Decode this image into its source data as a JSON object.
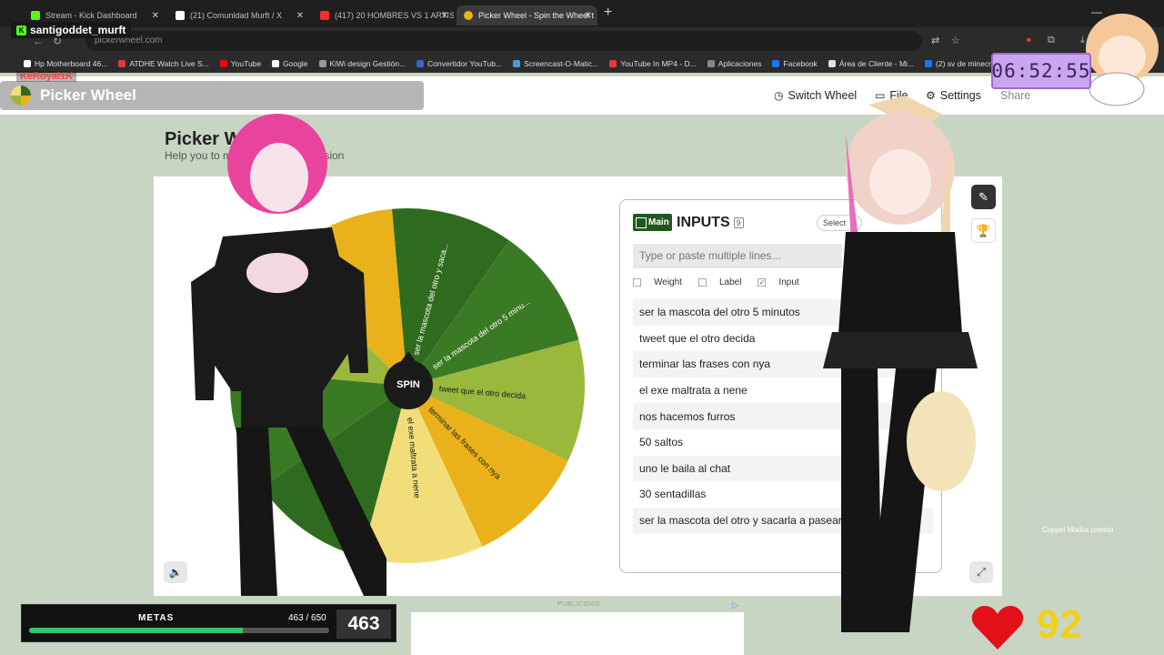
{
  "browser": {
    "tabs": [
      {
        "label": "Stream - Kick Dashboard",
        "color": "#53fc18",
        "active": false
      },
      {
        "label": "(21) Comunidad Murft / X",
        "color": "#ffffff",
        "active": false
      },
      {
        "label": "(417) 20 HOMBRES VS 1 ARTIS",
        "color": "#ff2a2a",
        "active": false
      },
      {
        "label": "Picker Wheel - Spin the Wheel t",
        "color": "#e9b21a",
        "active": true
      }
    ],
    "url": "pickerwheel.com",
    "bookmarks": [
      {
        "label": "Hp Motherboard 46...",
        "color": "#ffffff"
      },
      {
        "label": "ATDHE Watch Live S...",
        "color": "#e23a3a"
      },
      {
        "label": "YouTube",
        "color": "#ff0000"
      },
      {
        "label": "Google",
        "color": "#ffffff"
      },
      {
        "label": "KiWi design Gestión...",
        "color": "#999999"
      },
      {
        "label": "Convertidor YouTub...",
        "color": "#3366cc"
      },
      {
        "label": "Screencast-O-Matic...",
        "color": "#3aa0e6"
      },
      {
        "label": "YouTube In MP4 - D...",
        "color": "#e23a3a"
      },
      {
        "label": "Aplicaciones",
        "color": "#888888"
      },
      {
        "label": "Facebook",
        "color": "#1877f2"
      },
      {
        "label": "Área de Cliente - Mi...",
        "color": "#e0e0e0"
      },
      {
        "label": "(2) sv de minecraft...",
        "color": "#1877f2"
      }
    ]
  },
  "site": {
    "brand": "Picker Wheel",
    "nav": {
      "switch": "Switch Wheel",
      "file": "File",
      "settings": "Settings",
      "share": "Share"
    },
    "title": "Picker Wh",
    "subtitle_start": "Help you to m",
    "subtitle_end": "ecision"
  },
  "wheel": {
    "spin_label": "SPIN",
    "colors": [
      "#2f6b1e",
      "#3a7a24",
      "#9ab83b",
      "#e9b21a",
      "#f1de7a"
    ],
    "slices": [
      "ser la mascota del otro y saca...",
      "ser la mascota del otro 5 minu...",
      "tweet que el otro decida",
      "terminar las frases con nya",
      "el exe maltrata a nene"
    ]
  },
  "inputs": {
    "badge": "Main",
    "title": "INPUTS",
    "count": "9",
    "select": "Select",
    "placeholder": "Type or paste multiple lines...",
    "options": {
      "weight": "Weight",
      "label": "Label",
      "input": "Input"
    },
    "items": [
      "ser la mascota del otro 5 minutos",
      "tweet que el otro decida",
      "terminar las frases con nya",
      "el exe maltrata a nene",
      "nos hacemos furros",
      "50 saltos",
      "uno le baila al chat",
      "30 sentadillas",
      "ser la mascota del otro y sacarla a pasear"
    ]
  },
  "ad": {
    "label": "PUBLICIDAD"
  },
  "stream": {
    "chat_user": "santigoddet_murft",
    "chat_user2": "KeRoyal1K",
    "timer": "06:52:55",
    "metas": {
      "label": "METAS",
      "progress": "463 / 650",
      "current": "463",
      "fraction": 0.712
    },
    "hearts": "92",
    "ad_overlay": "Coppel\nModos premio"
  }
}
